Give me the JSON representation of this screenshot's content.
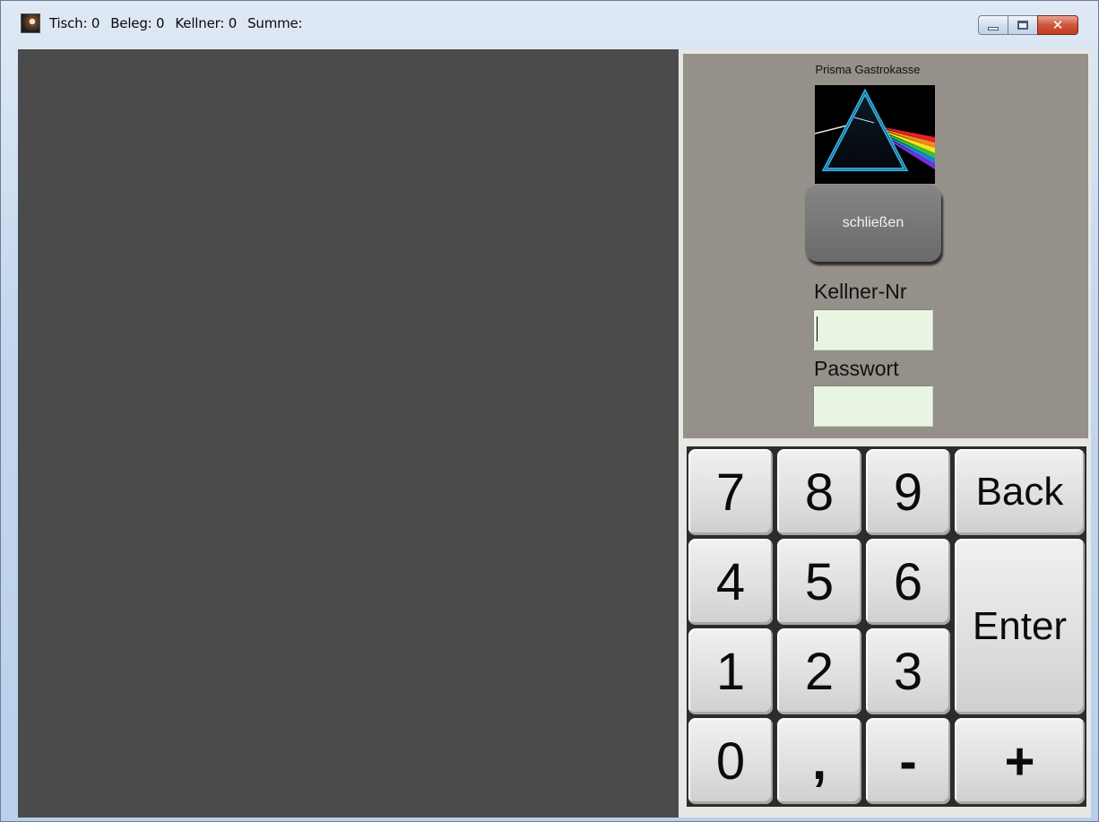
{
  "window": {
    "title": {
      "tisch": "Tisch: 0",
      "beleg": "Beleg: 0",
      "kellner": "Kellner: 0",
      "summe": "Summe:"
    },
    "controls": {
      "minimize": "minimize-icon",
      "maximize": "maximize-icon",
      "close": "close-icon"
    },
    "close_glyph": "✕"
  },
  "login": {
    "brand": "Prisma Gastrokasse",
    "close_button": "schließen",
    "kellner_label": "Kellner-Nr",
    "kellner_value": "",
    "passwort_label": "Passwort",
    "passwort_value": ""
  },
  "keypad": {
    "k7": "7",
    "k8": "8",
    "k9": "9",
    "back": "Back",
    "k4": "4",
    "k5": "5",
    "k6": "6",
    "enter": "Enter",
    "k1": "1",
    "k2": "2",
    "k3": "3",
    "k0": "0",
    "comma": ",",
    "minus": "-",
    "plus": "+"
  },
  "colors": {
    "left_pane": "#4b4b4b",
    "login_panel": "#959089",
    "input_bg": "#e8f5e2",
    "key_face": "#e2e2e2",
    "keypad_bg": "#2c2c2c"
  }
}
